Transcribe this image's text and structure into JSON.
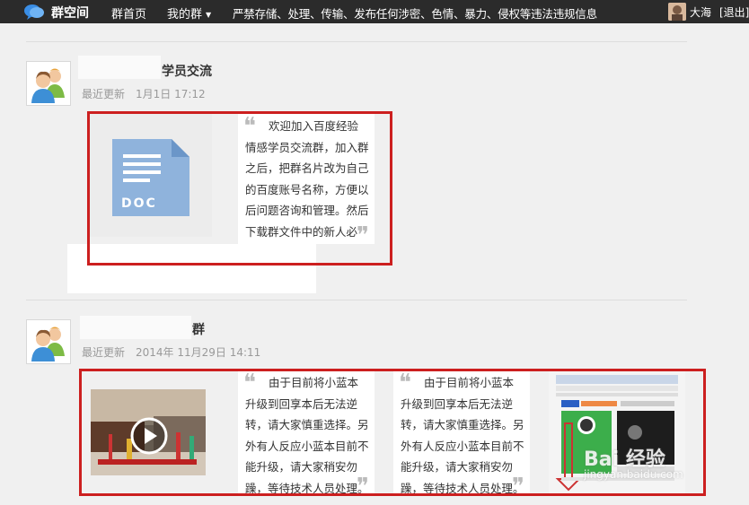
{
  "topbar": {
    "brand": "群空间",
    "nav_home": "群首页",
    "nav_mygroup": "我的群",
    "notice": "严禁存储、处理、传输、发布任何涉密、色情、暴力、侵权等违法违规信息",
    "username": "大海",
    "logout": "[退出]"
  },
  "posts": [
    {
      "title": "学员交流",
      "meta_label": "最近更新",
      "meta_time": "1月1日 17:12",
      "doc_label": "DOC",
      "quote": "欢迎加入百度经验情感学员交流群，加入群之后，把群名片改为自己的百度账号名称，方便以后问题咨询和管理。然后下载群文件中的新人必"
    },
    {
      "title": "群",
      "meta_label": "最近更新",
      "meta_time": "2014年 11月29日 14:11",
      "quote1": "由于目前将小蓝本升级到回享本后无法逆转，请大家慎重选择。另外有人反应小蓝本目前不能升级，请大家稍安勿躁，等待技术人员处理。经验平",
      "quote2": "由于目前将小蓝本升级到回享本后无法逆转，请大家慎重选择。另外有人反应小蓝本目前不能升级，请大家稍安勿躁，等待技术人员处理。经验平"
    }
  ],
  "watermark": {
    "text": "Bai 经验",
    "url": "jingyan.baidu.com"
  },
  "colors": {
    "topbar": "#2b2b2b",
    "highlight_box": "#cc1f1f",
    "doc_icon": "#8fb3dc"
  },
  "icons": [
    "chat-bubble-logo-icon",
    "caret-down-icon",
    "user-avatar-icon",
    "doc-file-icon",
    "play-icon",
    "quote-open-icon",
    "quote-close-icon",
    "grin-emoji-icon"
  ]
}
